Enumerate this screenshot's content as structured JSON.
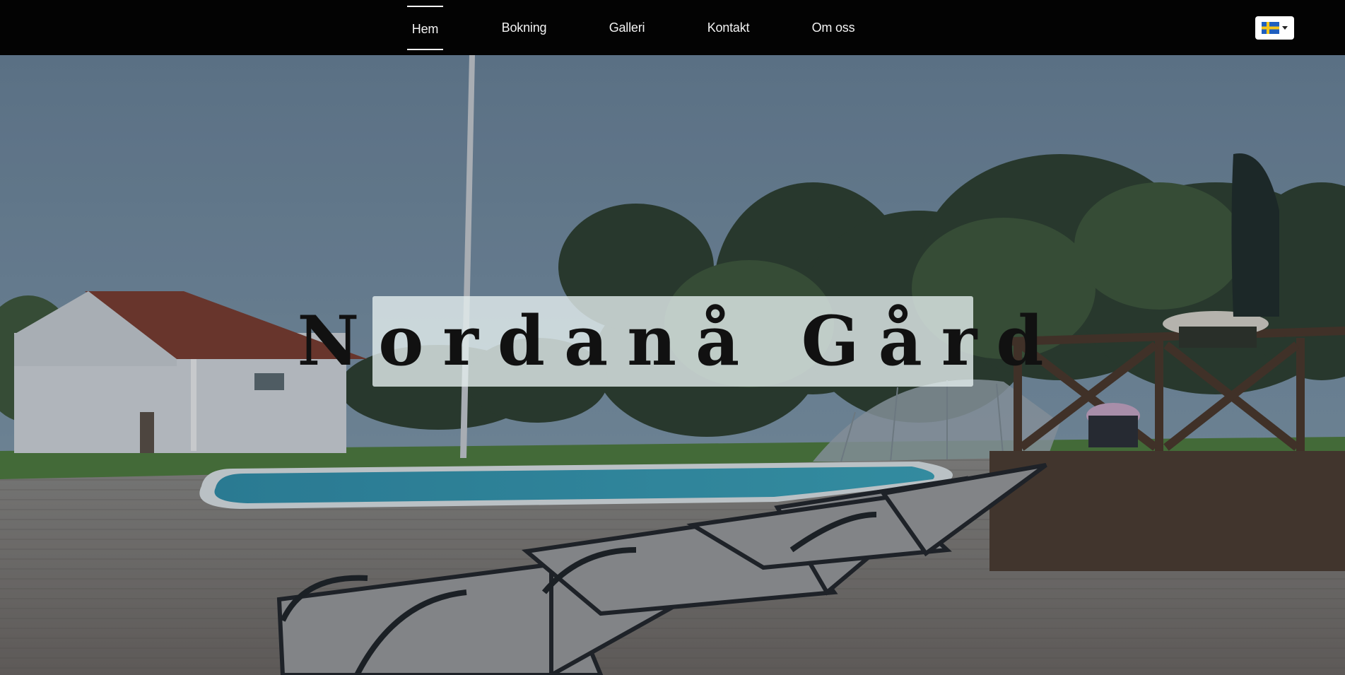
{
  "nav": {
    "items": [
      {
        "label": "Hem",
        "active": true
      },
      {
        "label": "Bokning",
        "active": false
      },
      {
        "label": "Galleri",
        "active": false
      },
      {
        "label": "Kontakt",
        "active": false
      },
      {
        "label": "Om oss",
        "active": false
      }
    ],
    "language": {
      "flag": "sweden-flag-icon",
      "colors": {
        "blue": "#1f5fbf",
        "yellow": "#f5c518"
      }
    }
  },
  "hero": {
    "title": "Nordanå Gård",
    "image": "pool-deck-farmhouse-photo"
  },
  "colors": {
    "navbar_bg": "#030303",
    "nav_text": "#f2f2f2",
    "title_box_bg": "#e4eeee"
  }
}
